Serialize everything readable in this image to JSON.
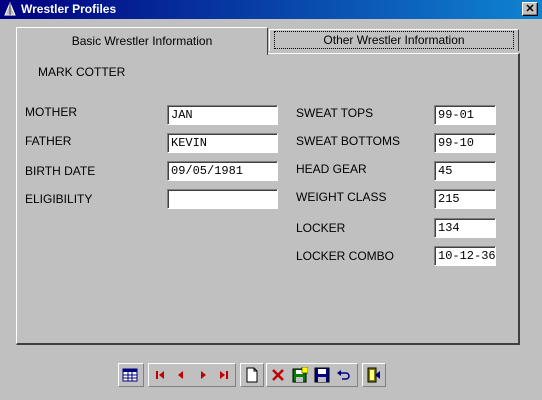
{
  "window": {
    "title": "Wrestler Profiles",
    "close_label": "✕"
  },
  "tabs": {
    "basic_label": "Basic Wrestler Information",
    "other_label": "Other Wrestler Information"
  },
  "wrestler": {
    "name": "MARK COTTER"
  },
  "left_fields": {
    "mother_label": "MOTHER",
    "mother_value": "JAN",
    "father_label": "FATHER",
    "father_value": "KEVIN",
    "birth_label": "BIRTH DATE",
    "birth_value": "09/05/1981",
    "eligibility_label": "ELIGIBILITY",
    "eligibility_value": ""
  },
  "right_fields": {
    "sweat_tops_label": "SWEAT TOPS",
    "sweat_tops_value": "99-01",
    "sweat_bottoms_label": "SWEAT BOTTOMS",
    "sweat_bottoms_value": "99-10",
    "head_gear_label": "HEAD GEAR",
    "head_gear_value": "45",
    "weight_class_label": "WEIGHT CLASS",
    "weight_class_value": "215",
    "locker_label": "LOCKER",
    "locker_value": "134",
    "locker_combo_label": "LOCKER COMBO",
    "locker_combo_value": "10-12-36"
  },
  "toolbar": {
    "icons": [
      "grid-icon",
      "first-record-icon",
      "previous-record-icon",
      "next-record-icon",
      "last-record-icon",
      "new-record-icon",
      "delete-icon",
      "save-add-icon",
      "save-icon",
      "undo-icon",
      "exit-icon"
    ]
  },
  "colors": {
    "titlebar_start": "#000080",
    "titlebar_end": "#1084d0",
    "face": "#c0c0c0",
    "nav_red": "#c00000"
  }
}
